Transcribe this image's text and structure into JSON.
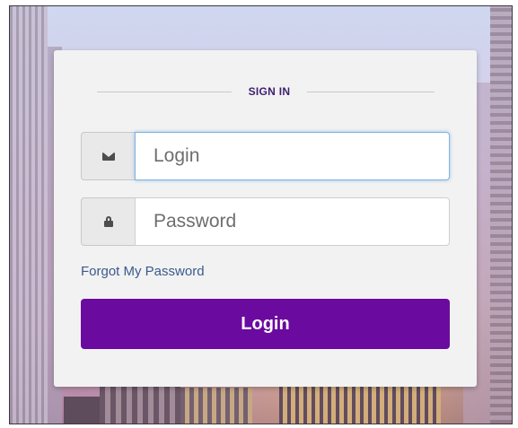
{
  "signin": {
    "heading": "SIGN IN",
    "login_field": {
      "placeholder": "Login",
      "value": "",
      "icon": "envelope-icon"
    },
    "password_field": {
      "placeholder": "Password",
      "value": "",
      "icon": "lock-icon"
    },
    "forgot_link": "Forgot My Password",
    "submit_label": "Login"
  },
  "colors": {
    "accent": "#6a0a9e",
    "heading": "#3d1f6e",
    "link": "#3b5a8c",
    "focus_border": "#7fb3e0"
  }
}
